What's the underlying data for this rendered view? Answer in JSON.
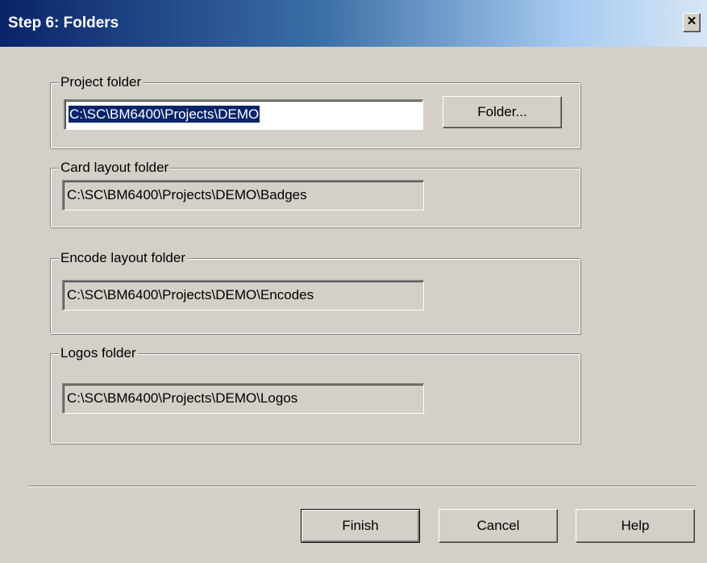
{
  "window": {
    "title": "Step 6: Folders",
    "close_glyph": "✕"
  },
  "groups": {
    "project": {
      "label": "Project folder",
      "value": "C:\\SC\\BM6400\\Projects\\DEMO",
      "folder_button": "Folder..."
    },
    "card_layout": {
      "label": "Card layout folder",
      "value": "C:\\SC\\BM6400\\Projects\\DEMO\\Badges"
    },
    "encode_layout": {
      "label": "Encode layout folder",
      "value": "C:\\SC\\BM6400\\Projects\\DEMO\\Encodes"
    },
    "logos": {
      "label": "Logos folder",
      "value": "C:\\SC\\BM6400\\Projects\\DEMO\\Logos"
    }
  },
  "buttons": {
    "finish": "Finish",
    "cancel": "Cancel",
    "help": "Help"
  },
  "colors": {
    "titlebar_start": "#0a246a",
    "titlebar_end": "#d7e6f5",
    "dialog_bg": "#d4d0c8",
    "selection": "#0a246a"
  }
}
